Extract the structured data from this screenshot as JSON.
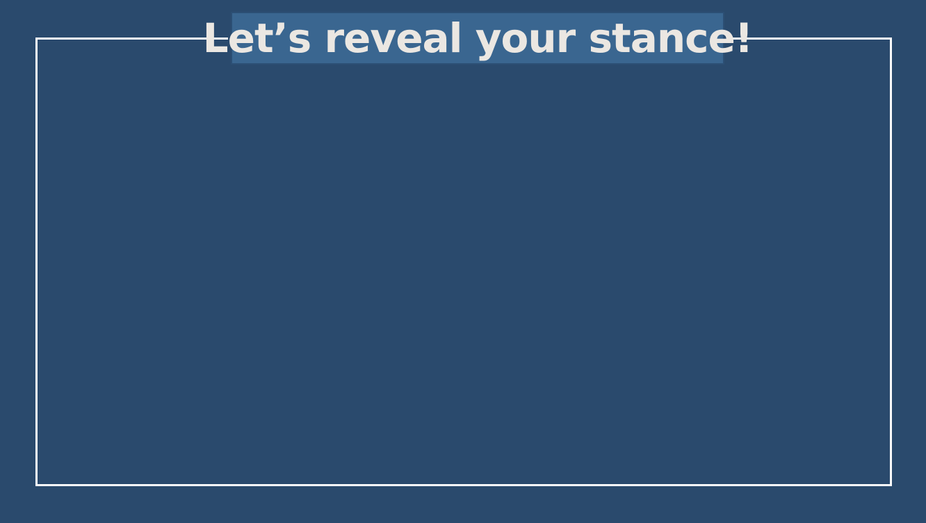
{
  "slide": {
    "title": "Let’s reveal your stance!"
  },
  "colors": {
    "background": "#2a4a6d",
    "title_box": "#3a6690",
    "frame": "#ffffff",
    "title_text": "#ebe7e2"
  }
}
